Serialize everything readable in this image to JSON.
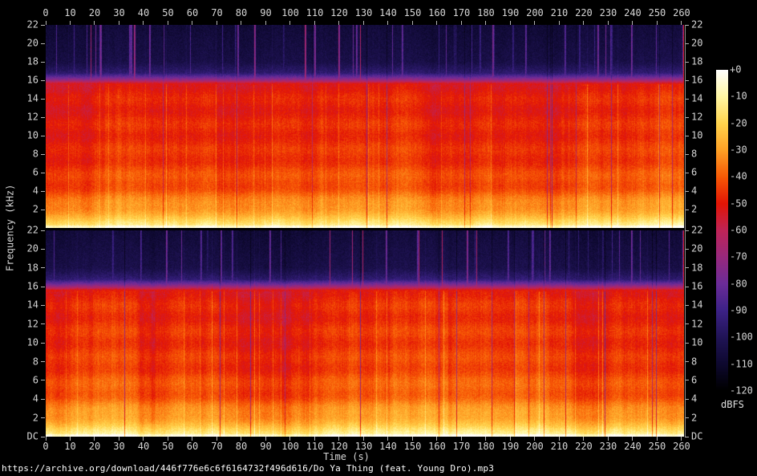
{
  "window": {
    "background": "#000000",
    "axis_color": "#b2b2b2",
    "text_color": "#d6d6d6"
  },
  "footer": {
    "url": "https://archive.org/download/446f776e6c6f6164732f496d616/Do Ya Thing (feat. Young Dro).mp3"
  },
  "chart_data": {
    "type": "heatmap",
    "subtype": "audio-spectrogram",
    "xlabel": "Time (s)",
    "ylabel": "Frequency (kHz)",
    "x_ticks": [
      0,
      10,
      20,
      30,
      40,
      50,
      60,
      70,
      80,
      90,
      100,
      110,
      120,
      130,
      140,
      150,
      160,
      170,
      180,
      190,
      200,
      210,
      220,
      230,
      240,
      250,
      260
    ],
    "x_range_s": [
      0,
      261
    ],
    "y_ticks_khz": [
      22,
      20,
      18,
      16,
      14,
      12,
      10,
      8,
      6,
      4,
      2
    ],
    "y_dc_label": "DC",
    "y_range_khz": [
      0,
      22
    ],
    "grid": false,
    "channels": [
      {
        "name": "channel-1",
        "seed": 1337
      },
      {
        "name": "channel-2",
        "seed": 90210
      }
    ],
    "lowpass_cutoff_khz": 16,
    "spectral_profile_db": [
      [
        0,
        -16
      ],
      [
        0.5,
        -20
      ],
      [
        1,
        -24
      ],
      [
        2,
        -30
      ],
      [
        4,
        -40
      ],
      [
        8,
        -46
      ],
      [
        12,
        -48
      ],
      [
        15.6,
        -50
      ],
      [
        16.1,
        -72
      ],
      [
        16.8,
        -95
      ],
      [
        18,
        -104
      ],
      [
        22,
        -108
      ]
    ],
    "colorbar": {
      "unit": "dBFS",
      "position": "right",
      "range_db": [
        0,
        -120
      ],
      "tick_labels": [
        "+0",
        "-10",
        "-20",
        "-30",
        "-40",
        "-50",
        "-60",
        "-70",
        "-80",
        "-90",
        "-100",
        "-110",
        "-120"
      ],
      "stops": [
        [
          0,
          "#ffffff"
        ],
        [
          -10,
          "#fff7a3"
        ],
        [
          -20,
          "#ffd44d"
        ],
        [
          -30,
          "#ffa126"
        ],
        [
          -40,
          "#f85a06"
        ],
        [
          -50,
          "#e31505"
        ],
        [
          -60,
          "#c02458"
        ],
        [
          -70,
          "#99297d"
        ],
        [
          -80,
          "#6c2c99"
        ],
        [
          -90,
          "#3d2287"
        ],
        [
          -100,
          "#211457"
        ],
        [
          -110,
          "#0e0930"
        ],
        [
          -120,
          "#000000"
        ]
      ]
    }
  }
}
